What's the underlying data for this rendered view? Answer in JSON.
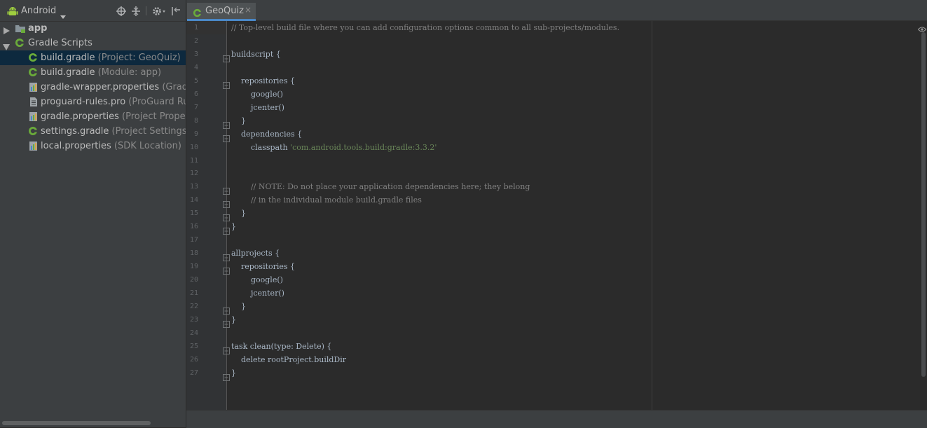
{
  "project_view": {
    "view_label": "Android",
    "toolbar_icons": [
      "target-icon",
      "collapse-all-icon",
      "gear-icon",
      "hide-panel-icon"
    ],
    "tree": [
      {
        "label": "app",
        "hint": "",
        "expanded": false,
        "icon": "folder-icon",
        "bold": true
      },
      {
        "label": "Gradle Scripts",
        "hint": "",
        "expanded": true,
        "icon": "gradle-icon",
        "bold": false
      },
      {
        "label": "build.gradle",
        "hint": " (Project: GeoQuiz)",
        "icon": "gradle-icon",
        "selected": true
      },
      {
        "label": "build.gradle",
        "hint": " (Module: app)",
        "icon": "gradle-icon"
      },
      {
        "label": "gradle-wrapper.properties",
        "hint": " (Gradle",
        "icon": "properties-icon"
      },
      {
        "label": "proguard-rules.pro",
        "hint": " (ProGuard Rule",
        "icon": "text-file-icon"
      },
      {
        "label": "gradle.properties",
        "hint": " (Project Propertie",
        "icon": "properties-icon"
      },
      {
        "label": "settings.gradle",
        "hint": " (Project Settings)",
        "icon": "gradle-icon"
      },
      {
        "label": "local.properties",
        "hint": " (SDK Location)",
        "icon": "properties-icon"
      }
    ]
  },
  "editor": {
    "tab": {
      "label": "GeoQuiz",
      "close": "×",
      "active": true
    },
    "lines": [
      {
        "n": "1",
        "text": "// Top-level build file where you can add configuration options common to all sub-projects/modules.",
        "kind": "comment"
      },
      {
        "n": "2",
        "text": ""
      },
      {
        "n": "3",
        "text": "buildscript {"
      },
      {
        "n": "4",
        "text": ""
      },
      {
        "n": "5",
        "text": "    repositories {"
      },
      {
        "n": "6",
        "text": "        google()"
      },
      {
        "n": "7",
        "text": "        jcenter()"
      },
      {
        "n": "8",
        "text": "    }"
      },
      {
        "n": "9",
        "text": "    dependencies {"
      },
      {
        "n": "10",
        "text": "        classpath ",
        "str": "'com.android.tools.build:gradle:3.3.2'"
      },
      {
        "n": "11",
        "text": ""
      },
      {
        "n": "12",
        "text": ""
      },
      {
        "n": "13",
        "text": "        // NOTE: Do not place your application dependencies here; they belong",
        "kind": "comment"
      },
      {
        "n": "14",
        "text": "        // in the individual module build.gradle files",
        "kind": "comment"
      },
      {
        "n": "15",
        "text": "    }"
      },
      {
        "n": "16",
        "text": "}"
      },
      {
        "n": "17",
        "text": ""
      },
      {
        "n": "18",
        "text": "allprojects {"
      },
      {
        "n": "19",
        "text": "    repositories {"
      },
      {
        "n": "20",
        "text": "        google()"
      },
      {
        "n": "21",
        "text": "        jcenter()"
      },
      {
        "n": "22",
        "text": "    }"
      },
      {
        "n": "23",
        "text": "}"
      },
      {
        "n": "24",
        "text": ""
      },
      {
        "n": "25",
        "text": "task clean(type: Delete) {"
      },
      {
        "n": "26",
        "text": "    delete rootProject.buildDir"
      },
      {
        "n": "27",
        "text": "}"
      }
    ],
    "fold_markers_on_lines": [
      "3",
      "5",
      "8",
      "9",
      "13",
      "14",
      "15",
      "16",
      "18",
      "19",
      "22",
      "23",
      "25",
      "27"
    ]
  },
  "colors": {
    "panel_bg": "#3c3f41",
    "editor_bg": "#2b2b2b",
    "gutter_bg": "#313335",
    "selection_bg": "#0d293e",
    "tab_underline": "#4a88c7",
    "gradle_green": "#6aab3a",
    "string": "#6a8759",
    "comment": "#808080",
    "code_text": "#a9b7c6"
  }
}
